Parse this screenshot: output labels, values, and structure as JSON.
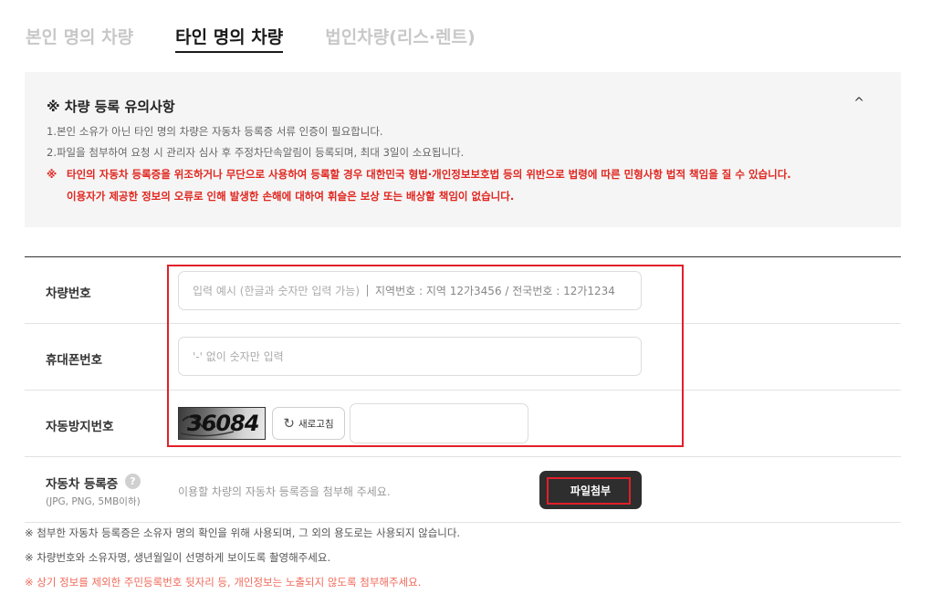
{
  "tabs": [
    {
      "label": "본인 명의 차량",
      "active": false
    },
    {
      "label": "타인 명의 차량",
      "active": true
    },
    {
      "label": "법인차량(리스·렌트)",
      "active": false
    }
  ],
  "notice": {
    "title": "※ 차량 등록 유의사항",
    "toggle_icon": "^",
    "lines": [
      "1.본인 소유가 아닌 타인 명의 차량은 자동차 등록증 서류 인증이 필요합니다.",
      "2.파일을 첨부하여 요청 시 관리자 심사 후 주정차단속알림이 등록되며, 최대 3일이 소요됩니다."
    ],
    "warning_mark": "※",
    "warning_line1": "타인의 자동차 등록증을 위조하거나 무단으로 사용하여 등록할 경우 대한민국 형법·개인정보보호법 등의 위반으로 법령에 따른 민형사항 법적 책임을 질 수 있습니다.",
    "warning_line2": "이용자가 제공한 정보의 오류로 인해 발생한 손해에 대하여 휘슬은 보상 또는 배상할 책임이 없습니다."
  },
  "form": {
    "vehicle_number": {
      "label": "차량번호",
      "placeholder_main": "입력 예시 (한글과 숫자만 입력 가능)",
      "placeholder_extra": "지역번호 : 지역 12가3456 / 전국번호 : 12가1234",
      "value": ""
    },
    "phone": {
      "label": "휴대폰번호",
      "placeholder": "'-' 없이 숫자만 입력",
      "value": ""
    },
    "captcha": {
      "label": "자동방지번호",
      "image_text": "36084",
      "refresh_label": "새로고침",
      "value": ""
    },
    "registration": {
      "label": "자동차 등록증",
      "sublabel": "(JPG, PNG, 5MB이하)",
      "help_icon": "?",
      "hint": "이용할 차량의 자동차 등록증을 첨부해 주세요.",
      "attach_label": "파일첨부"
    }
  },
  "footnotes": [
    {
      "text": "※ 첨부한 자동차 등록증은 소유자 명의 확인을 위해 사용되며, 그 외의 용도로는 사용되지 않습니다.",
      "red": false
    },
    {
      "text": "※ 차량번호와 소유자명, 생년월일이 선명하게 보이도록 촬영해주세요.",
      "red": false
    },
    {
      "text": "※ 상기 정보를 제외한 주민등록번호 뒷자리 등, 개인정보는 노출되지 않도록 첨부해주세요.",
      "red": true
    }
  ],
  "colors": {
    "highlight_red": "#e0202a",
    "warning_red": "#e0261f",
    "note_red": "#f06a5a",
    "button_dark": "#2e2e2e",
    "notice_bg": "#f5f5f5"
  }
}
